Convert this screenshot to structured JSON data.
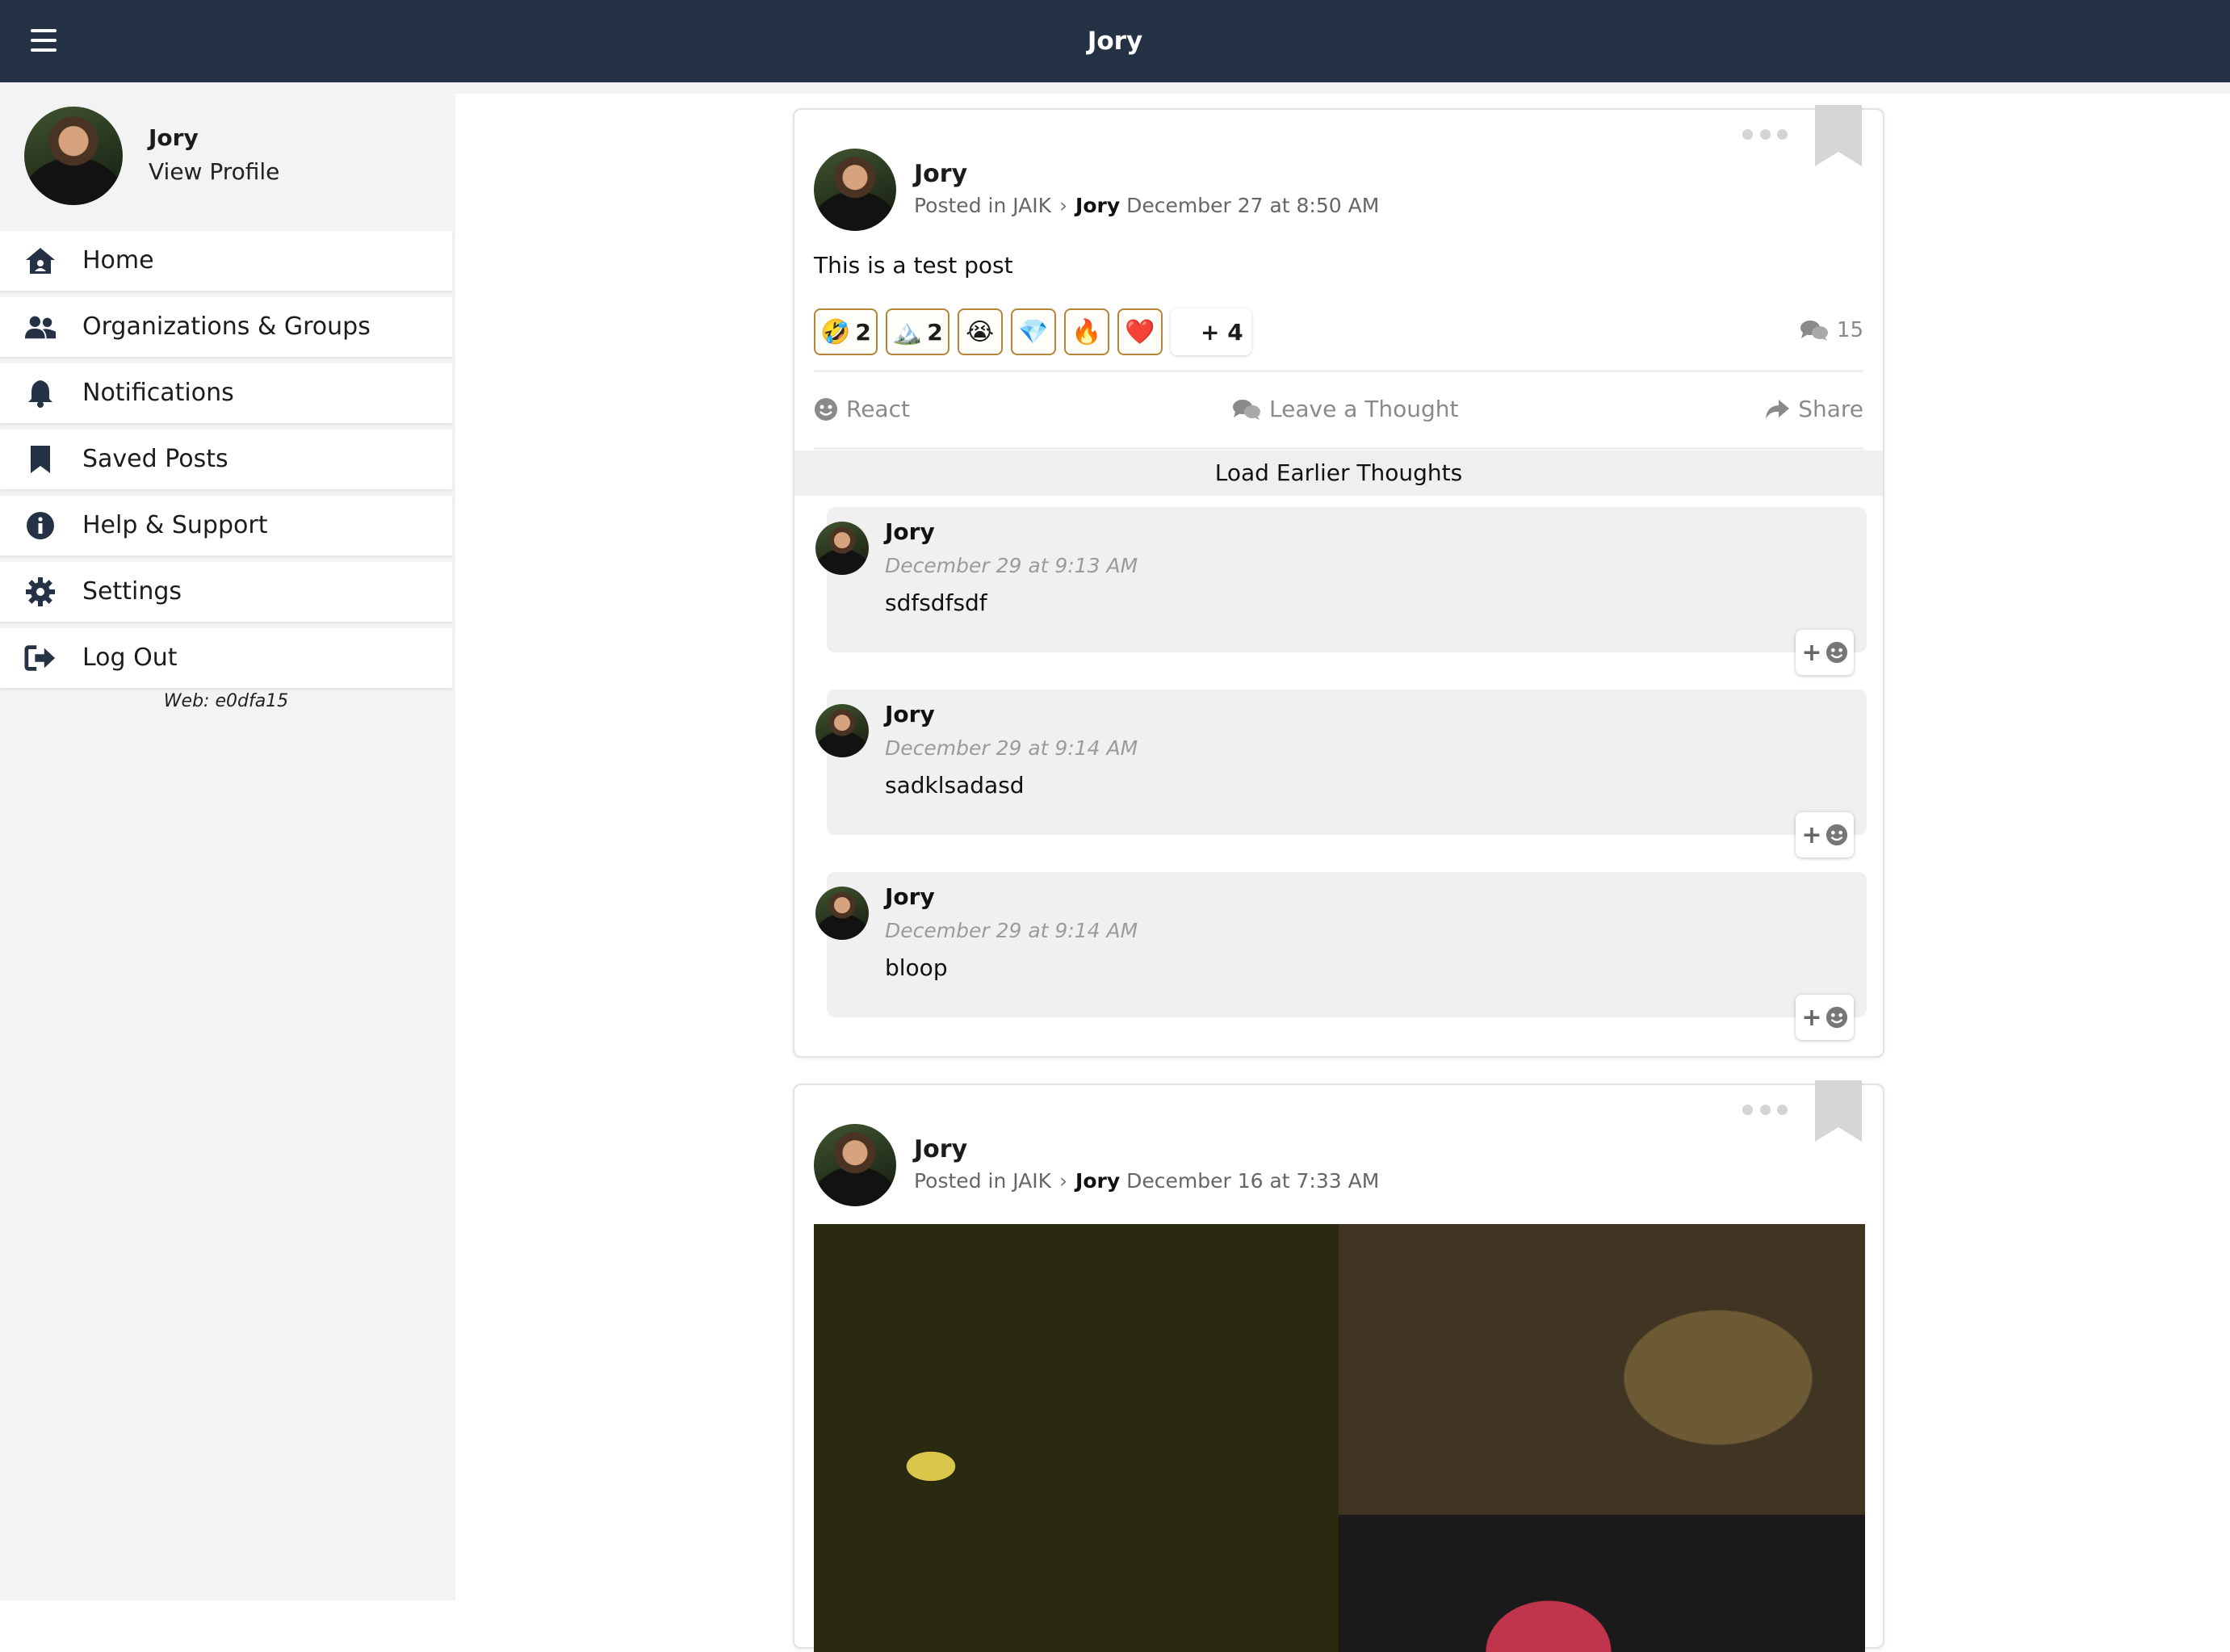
{
  "header": {
    "title": "Jory"
  },
  "sidebar": {
    "profile": {
      "name": "Jory",
      "link": "View Profile"
    },
    "items": [
      {
        "label": "Home",
        "icon": "home-icon"
      },
      {
        "label": "Organizations & Groups",
        "icon": "users-icon"
      },
      {
        "label": "Notifications",
        "icon": "bell-icon"
      },
      {
        "label": "Saved Posts",
        "icon": "bookmark-icon"
      },
      {
        "label": "Help & Support",
        "icon": "info-icon"
      },
      {
        "label": "Settings",
        "icon": "gear-icon"
      },
      {
        "label": "Log Out",
        "icon": "logout-icon"
      }
    ],
    "version": "Web: e0dfa15"
  },
  "posts": [
    {
      "author": "Jory",
      "posted_in_prefix": "Posted in JAIK",
      "posted_in_target": "Jory",
      "timestamp": "December 27 at 8:50 AM",
      "body": "This is a test post",
      "reactions": [
        {
          "emoji": "🤣",
          "count": "2"
        },
        {
          "emoji": "🏔️",
          "count": "2"
        },
        {
          "emoji": "😭",
          "count": ""
        },
        {
          "emoji": "💎",
          "count": ""
        },
        {
          "emoji": "🔥",
          "count": ""
        },
        {
          "emoji": "❤️",
          "count": ""
        }
      ],
      "reactions_more": "+ 4",
      "comment_count": "15",
      "actions": {
        "react": "React",
        "thought": "Leave a Thought",
        "share": "Share"
      },
      "load_earlier": "Load Earlier Thoughts",
      "thoughts": [
        {
          "author": "Jory",
          "time": "December 29 at 9:13 AM",
          "text": "sdfsdfsdf"
        },
        {
          "author": "Jory",
          "time": "December 29 at 9:14 AM",
          "text": "sadklsadasd"
        },
        {
          "author": "Jory",
          "time": "December 29 at 9:14 AM",
          "text": "bloop"
        }
      ],
      "thought_react_label": "+"
    },
    {
      "author": "Jory",
      "posted_in_prefix": "Posted in JAIK",
      "posted_in_target": "Jory",
      "timestamp": "December 16 at 7:33 AM"
    }
  ],
  "colors": {
    "topbar": "#253245",
    "sidebar_bg": "#f3f3f3",
    "reaction_border": "#b58538",
    "muted_text": "#8a8a8a"
  }
}
